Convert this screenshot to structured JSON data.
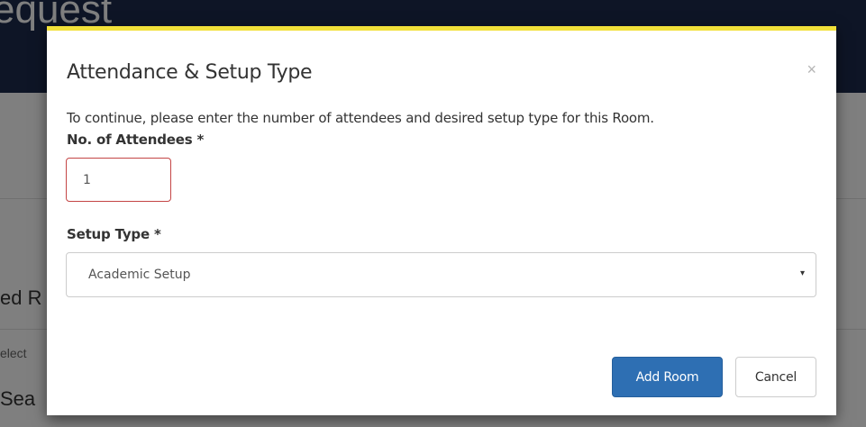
{
  "background": {
    "header_title": "equest",
    "section_title": "ed R",
    "helper_text": "elect",
    "search_text": "Sea"
  },
  "modal": {
    "title": "Attendance & Setup Type",
    "close_icon": "×",
    "intro": "To continue, please enter the number of attendees and desired setup type for this Room.",
    "attendees_label": "No. of Attendees *",
    "attendees_value": "1",
    "setup_label": "Setup Type *",
    "setup_selected": "Academic Setup",
    "caret_icon": "▾",
    "add_button": "Add Room",
    "cancel_button": "Cancel"
  },
  "colors": {
    "header_bg": "#1c2b4c",
    "modal_accent": "#f2e13a",
    "primary_button": "#2e6fb3",
    "invalid_border": "#c44545"
  }
}
